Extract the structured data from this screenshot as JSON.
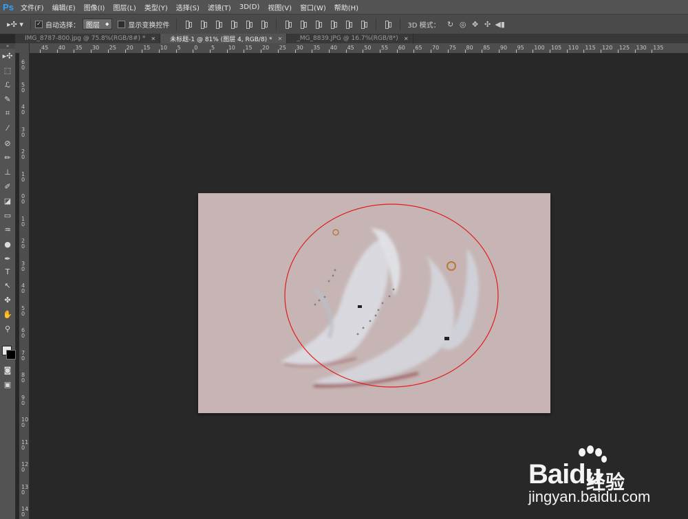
{
  "app": {
    "logo": "Ps"
  },
  "menu": [
    "文件(F)",
    "编辑(E)",
    "图像(I)",
    "图层(L)",
    "类型(Y)",
    "选择(S)",
    "滤镜(T)",
    "3D(D)",
    "视图(V)",
    "窗口(W)",
    "帮助(H)"
  ],
  "options": {
    "auto_select_label": "自动选择：",
    "auto_select_checked": true,
    "layer_dropdown": "图层",
    "show_transform_label": "显示变换控件",
    "show_transform_checked": false,
    "mode_label": "3D 模式："
  },
  "tabs": [
    {
      "label": "IMG_8787-800.jpg @ 75.8%(RGB/8#) *",
      "active": false
    },
    {
      "label": "未标题-1 @ 81% (图层 4, RGB/8) *",
      "active": true
    },
    {
      "label": "_MG_8839.JPG @ 16.7%(RGB/8*)",
      "active": false
    }
  ],
  "ruler_top": [
    "45",
    "40",
    "35",
    "30",
    "25",
    "20",
    "15",
    "10",
    "5",
    "0",
    "5",
    "10",
    "15",
    "20",
    "25",
    "30",
    "35",
    "40",
    "45",
    "50",
    "55",
    "60",
    "65",
    "70",
    "75",
    "80",
    "85",
    "90",
    "95",
    "100",
    "105",
    "110",
    "115",
    "120",
    "125",
    "130",
    "135"
  ],
  "ruler_left": [
    "6",
    "5",
    "4",
    "3",
    "2",
    "1",
    "0",
    "1",
    "2",
    "3",
    "4",
    "5",
    "6",
    "7",
    "8",
    "9",
    "10",
    "11",
    "12",
    "13",
    "14"
  ],
  "tools": [
    "move-tool",
    "marquee-tool",
    "lasso-tool",
    "quick-select-tool",
    "crop-tool",
    "eyedropper-tool",
    "healing-brush-tool",
    "brush-tool",
    "clone-stamp-tool",
    "history-brush-tool",
    "eraser-tool",
    "gradient-tool",
    "blur-tool",
    "dodge-tool",
    "pen-tool",
    "type-tool",
    "path-select-tool",
    "shape-tool",
    "hand-tool",
    "zoom-tool"
  ],
  "colors": {
    "canvas": "#c6b5b4",
    "selection": "#e11a1a",
    "accent": "#2fa3ff"
  },
  "watermark": {
    "brand": "Bai",
    "brand2": "du",
    "jingyan": "经验",
    "url": "jingyan.baidu.com"
  }
}
